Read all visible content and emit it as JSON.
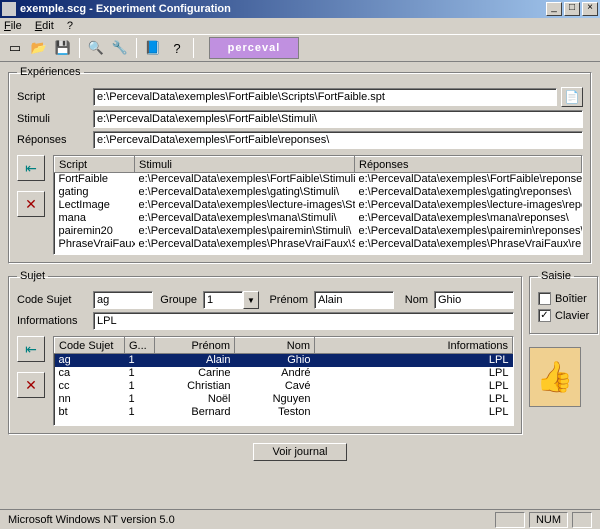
{
  "window": {
    "title": "exemple.scg - Experiment Configuration"
  },
  "menu": {
    "file": "File",
    "edit": "Edit",
    "help": "?"
  },
  "banner": "perceval",
  "exp": {
    "legend": "Expériences",
    "script_label": "Script",
    "script_value": "e:\\PercevalData\\exemples\\FortFaible\\Scripts\\FortFaible.spt",
    "stimuli_label": "Stimuli",
    "stimuli_value": "e:\\PercevalData\\exemples\\FortFaible\\Stimuli\\",
    "reponses_label": "Réponses",
    "reponses_value": "e:\\PercevalData\\exemples\\FortFaible\\reponses\\",
    "cols": {
      "script": "Script",
      "stimuli": "Stimuli",
      "reponses": "Réponses"
    },
    "rows": [
      {
        "script": "FortFaible",
        "stimuli": "e:\\PercevalData\\exemples\\FortFaible\\Stimuli\\",
        "reponses": "e:\\PercevalData\\exemples\\FortFaible\\reponses\\"
      },
      {
        "script": "gating",
        "stimuli": "e:\\PercevalData\\exemples\\gating\\Stimuli\\",
        "reponses": "e:\\PercevalData\\exemples\\gating\\reponses\\"
      },
      {
        "script": "LectImage",
        "stimuli": "e:\\PercevalData\\exemples\\lecture-images\\Stimuli\\",
        "reponses": "e:\\PercevalData\\exemples\\lecture-images\\reponses\\"
      },
      {
        "script": "mana",
        "stimuli": "e:\\PercevalData\\exemples\\mana\\Stimuli\\",
        "reponses": "e:\\PercevalData\\exemples\\mana\\reponses\\"
      },
      {
        "script": "pairemin20",
        "stimuli": "e:\\PercevalData\\exemples\\pairemin\\Stimuli\\",
        "reponses": "e:\\PercevalData\\exemples\\pairemin\\reponses\\"
      },
      {
        "script": "PhraseVraiFaux",
        "stimuli": "e:\\PercevalData\\exemples\\PhraseVraiFaux\\Stimuli\\",
        "reponses": "e:\\PercevalData\\exemples\\PhraseVraiFaux\\reponses\\"
      }
    ]
  },
  "sujet": {
    "legend": "Sujet",
    "code_label": "Code Sujet",
    "code_value": "ag",
    "groupe_label": "Groupe",
    "groupe_value": "1",
    "prenom_label": "Prénom",
    "prenom_value": "Alain",
    "nom_label": "Nom",
    "nom_value": "Ghio",
    "info_label": "Informations",
    "info_value": "LPL",
    "cols": {
      "code": "Code Sujet",
      "groupe": "G...",
      "prenom": "Prénom",
      "nom": "Nom",
      "info": "Informations"
    },
    "rows": [
      {
        "code": "ag",
        "groupe": "1",
        "prenom": "Alain",
        "nom": "Ghio",
        "info": "LPL"
      },
      {
        "code": "ca",
        "groupe": "1",
        "prenom": "Carine",
        "nom": "André",
        "info": "LPL"
      },
      {
        "code": "cc",
        "groupe": "1",
        "prenom": "Christian",
        "nom": "Cavé",
        "info": "LPL"
      },
      {
        "code": "nn",
        "groupe": "1",
        "prenom": "Noël",
        "nom": "Nguyen",
        "info": "LPL"
      },
      {
        "code": "bt",
        "groupe": "1",
        "prenom": "Bernard",
        "nom": "Teston",
        "info": "LPL"
      }
    ]
  },
  "saisie": {
    "legend": "Saisie",
    "boitier": "Boîtier",
    "clavier": "Clavier"
  },
  "buttons": {
    "voir_journal": "Voir journal"
  },
  "status": {
    "os": "Microsoft Windows NT version 5.0",
    "num": "NUM"
  }
}
